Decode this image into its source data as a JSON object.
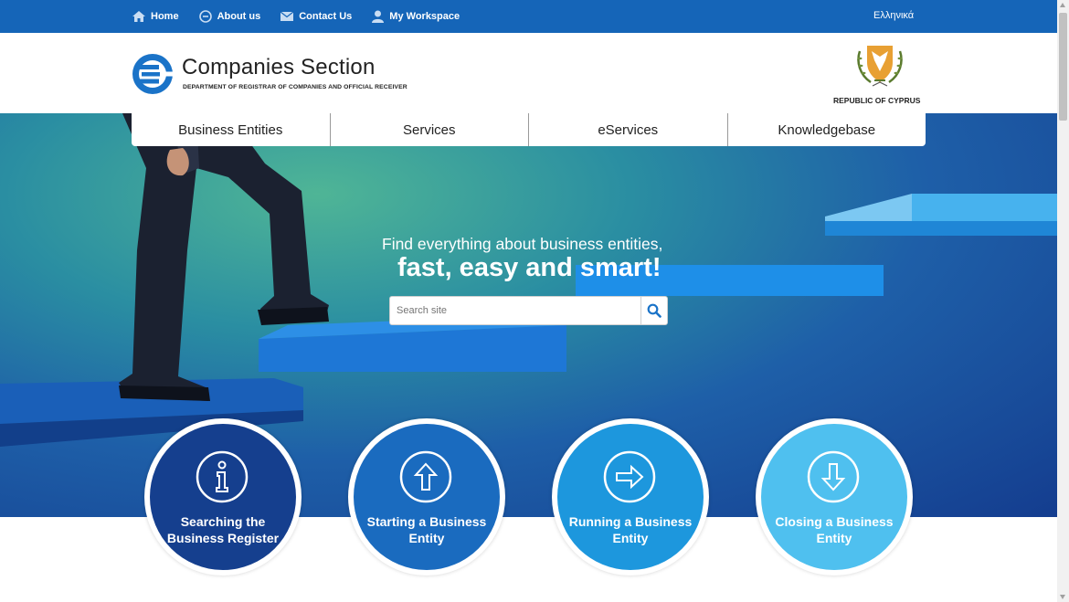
{
  "topnav": {
    "items": [
      {
        "label": "Home",
        "icon": "home-icon"
      },
      {
        "label": "About us",
        "icon": "info-circle-icon"
      },
      {
        "label": "Contact Us",
        "icon": "envelope-icon"
      },
      {
        "label": "My Workspace",
        "icon": "user-icon"
      }
    ],
    "language": "Ελληνικά"
  },
  "brand": {
    "title": "Companies Section",
    "subtitle": "DEPARTMENT OF REGISTRAR OF COMPANIES AND OFFICIAL RECEIVER",
    "republic": "REPUBLIC OF CYPRUS"
  },
  "mainnav": {
    "tabs": [
      {
        "label": "Business Entities"
      },
      {
        "label": "Services"
      },
      {
        "label": "eServices"
      },
      {
        "label": "Knowledgebase"
      }
    ]
  },
  "hero": {
    "line1": "Find everything about business entities,",
    "line2": "fast, easy and smart!"
  },
  "search": {
    "placeholder": "Search site"
  },
  "circles": [
    {
      "line1": "Searching the",
      "line2": "Business Register",
      "color": "#153f8e",
      "icon": "info-icon"
    },
    {
      "line1": "Starting a Business",
      "line2": "Entity",
      "color": "#1a6bbf",
      "icon": "arrow-up-icon"
    },
    {
      "line1": "Running a Business",
      "line2": "Entity",
      "color": "#1d97dd",
      "icon": "arrow-right-icon"
    },
    {
      "line1": "Closing a Business",
      "line2": "Entity",
      "color": "#4fc0ef",
      "icon": "arrow-down-icon"
    }
  ],
  "colors": {
    "topbar": "#1565b8",
    "brand_blue": "#1a73c8"
  }
}
